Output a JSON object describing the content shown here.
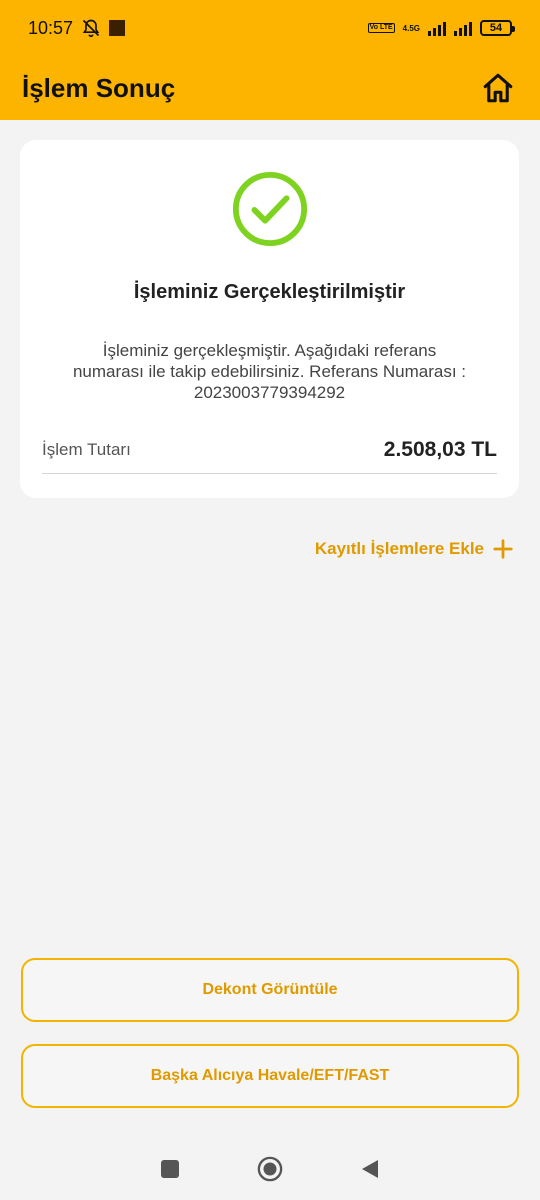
{
  "status_bar": {
    "time": "10:57",
    "network_label": "4.5G",
    "volte_label": "Vo LTE",
    "battery": "54"
  },
  "header": {
    "title": "İşlem Sonuç",
    "home_icon": "home-icon",
    "bg_color": "#fdb400"
  },
  "result": {
    "icon": "check-circle-icon",
    "icon_color": "#7ed321",
    "heading": "İşleminiz Gerçekleştirilmiştir",
    "description": "İşleminiz gerçekleşmiştir. Aşağıdaki referans numarası ile takip edebilirsiniz. Referans Numarası : 2023003779394292",
    "amount_label": "İşlem Tutarı",
    "amount_value": "2.508,03 TL"
  },
  "actions": {
    "add_saved_label": "Kayıtlı İşlemlere Ekle",
    "view_receipt_label": "Dekont Görüntüle",
    "other_recipient_label": "Başka Alıcıya Havale/EFT/FAST",
    "accent_color": "#e09a00"
  },
  "nav": {
    "recents_icon": "square-icon",
    "home_icon": "circle-icon",
    "back_icon": "triangle-back-icon"
  }
}
